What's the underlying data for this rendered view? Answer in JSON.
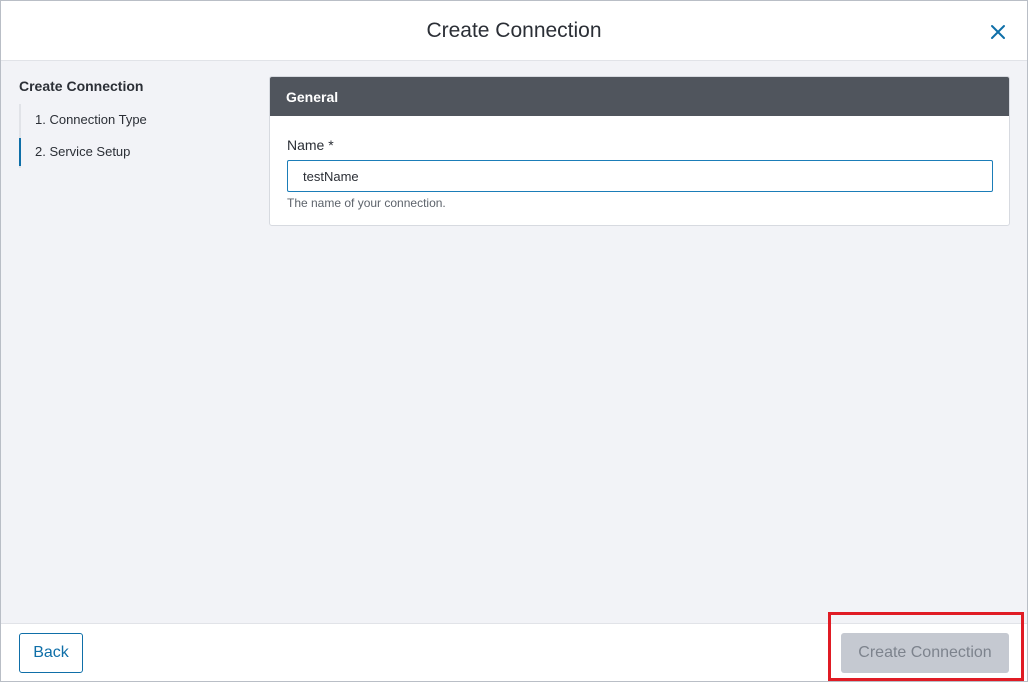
{
  "dialog": {
    "title": "Create Connection",
    "close_icon": "close-icon"
  },
  "sidebar": {
    "title": "Create Connection",
    "steps": [
      {
        "label": "1. Connection Type",
        "active": false
      },
      {
        "label": "2. Service Setup",
        "active": true
      }
    ]
  },
  "general_panel": {
    "heading": "General",
    "name_field": {
      "label": "Name *",
      "value": "testName",
      "hint": "The name of your connection."
    }
  },
  "footer": {
    "back_label": "Back",
    "create_label": "Create Connection",
    "create_disabled": true
  },
  "colors": {
    "accent": "#0f6fa8",
    "panel_header": "#50555d",
    "highlight": "#e01b24"
  }
}
